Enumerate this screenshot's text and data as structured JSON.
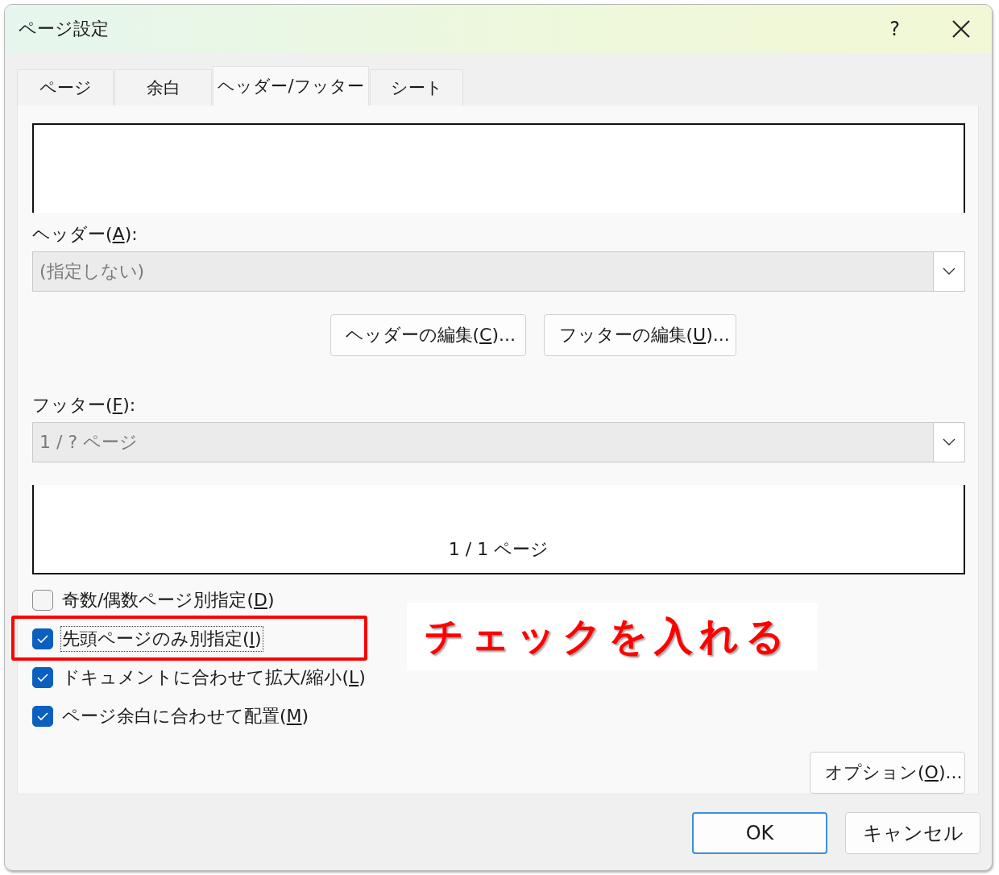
{
  "window": {
    "title": "ページ設定",
    "help_button": "?"
  },
  "tabs": [
    {
      "label": "ページ",
      "selected": false
    },
    {
      "label": "余白",
      "selected": false
    },
    {
      "label": "ヘッダー/フッター",
      "selected": true
    },
    {
      "label": "シート",
      "selected": false
    }
  ],
  "header": {
    "label": "ヘッダー(",
    "access_key": "A",
    "label_end": "):",
    "value": "(指定しない)",
    "disabled": true
  },
  "edit_buttons": [
    {
      "label": "ヘッダーの編集(",
      "access_key": "C",
      "label_end": ")..."
    },
    {
      "label": "フッターの編集(",
      "access_key": "U",
      "label_end": ")..."
    }
  ],
  "footer": {
    "label": "フッター(",
    "access_key": "F",
    "label_end": "):",
    "value": "1 / ? ページ",
    "disabled": true
  },
  "footer_preview": {
    "text": "1 / 1 ページ"
  },
  "checkboxes": [
    {
      "label": "奇数/偶数ページ別指定(",
      "access_key": "D",
      "label_end": ")",
      "checked": false,
      "focused": false
    },
    {
      "label": "先頭ページのみ別指定(",
      "access_key": "I",
      "label_end": ")",
      "checked": true,
      "focused": true
    },
    {
      "label": "ドキュメントに合わせて拡大/縮小(",
      "access_key": "L",
      "label_end": ")",
      "checked": true,
      "focused": false
    },
    {
      "label": "ページ余白に合わせて配置(",
      "access_key": "M",
      "label_end": ")",
      "checked": true,
      "focused": false
    }
  ],
  "options_button": {
    "label": "オプション(",
    "access_key": "O",
    "label_end": ")..."
  },
  "footer_buttons": [
    {
      "label": "OK",
      "default": true
    },
    {
      "label": "キャンセル",
      "default": false
    }
  ],
  "annotation": {
    "text": "チェックを入れる"
  }
}
